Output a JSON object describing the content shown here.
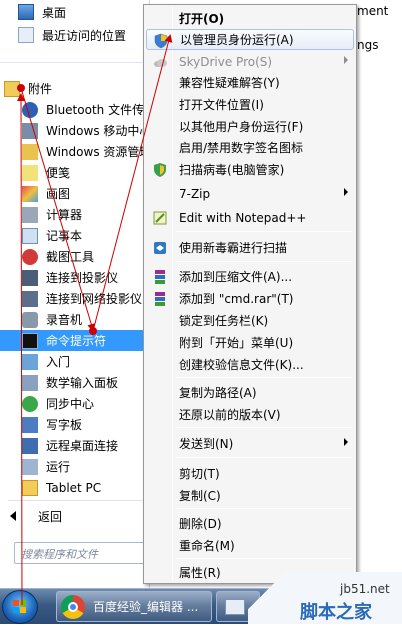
{
  "start_menu": {
    "top_items": [
      {
        "label": "桌面",
        "icon": "desktop-icon"
      },
      {
        "label": "最近访问的位置",
        "icon": "recent-places-icon"
      }
    ],
    "folder": {
      "label": "附件",
      "icon": "folder-icon"
    },
    "programs": [
      {
        "label": "Bluetooth 文件传送",
        "icon": "bluetooth-icon"
      },
      {
        "label": "Windows 移动中心",
        "icon": "mobility-center-icon"
      },
      {
        "label": "Windows 资源管理器",
        "icon": "explorer-icon"
      },
      {
        "label": "便笺",
        "icon": "sticky-notes-icon"
      },
      {
        "label": "画图",
        "icon": "paint-icon"
      },
      {
        "label": "计算器",
        "icon": "calculator-icon"
      },
      {
        "label": "记事本",
        "icon": "notepad-icon"
      },
      {
        "label": "截图工具",
        "icon": "snipping-tool-icon"
      },
      {
        "label": "连接到投影仪",
        "icon": "projector-icon"
      },
      {
        "label": "连接到网络投影仪",
        "icon": "network-projector-icon"
      },
      {
        "label": "录音机",
        "icon": "sound-recorder-icon"
      },
      {
        "label": "命令提示符",
        "icon": "command-prompt-icon"
      },
      {
        "label": "入门",
        "icon": "getting-started-icon"
      },
      {
        "label": "数学输入面板",
        "icon": "math-input-icon"
      },
      {
        "label": "同步中心",
        "icon": "sync-center-icon"
      },
      {
        "label": "写字板",
        "icon": "wordpad-icon"
      },
      {
        "label": "远程桌面连接",
        "icon": "remote-desktop-icon"
      },
      {
        "label": "运行",
        "icon": "run-icon"
      },
      {
        "label": "Tablet PC",
        "icon": "folder-icon"
      }
    ],
    "back_label": "返回",
    "search_placeholder": "搜索程序和文件"
  },
  "right_fragments": [
    "ment",
    "ngs"
  ],
  "context_menu": {
    "items": [
      {
        "label": "打开(O)",
        "bold": true
      },
      {
        "label": "以管理员身份运行(A)",
        "icon": "uac-shield-icon",
        "hover": true
      },
      {
        "label": "SkyDrive Pro(S)",
        "icon": "cloud-icon",
        "disabled": true,
        "submenu": true
      },
      {
        "label": "兼容性疑难解答(Y)"
      },
      {
        "label": "打开文件位置(I)"
      },
      {
        "label": "以其他用户身份运行(F)"
      },
      {
        "label": "启用/禁用数字签名图标"
      },
      {
        "label": "扫描病毒(电脑管家)",
        "icon": "antivirus-shield-icon"
      },
      {
        "label": "7-Zip",
        "submenu": true
      },
      {
        "label": "Edit with Notepad++",
        "icon": "notepadpp-icon"
      },
      {
        "label": "使用新毒霸进行扫描",
        "icon": "duba-icon"
      },
      {
        "label": "添加到压缩文件(A)...",
        "icon": "winrar-icon"
      },
      {
        "label": "添加到 \"cmd.rar\"(T)",
        "icon": "winrar-icon"
      },
      {
        "label": "锁定到任务栏(K)"
      },
      {
        "label": "附到「开始」菜单(U)"
      },
      {
        "label": "创建校验信息文件(K)..."
      },
      {
        "label": "复制为路径(A)"
      },
      {
        "label": "还原以前的版本(V)"
      },
      {
        "label": "发送到(N)",
        "submenu": true
      },
      {
        "label": "剪切(T)"
      },
      {
        "label": "复制(C)"
      },
      {
        "label": "删除(D)"
      },
      {
        "label": "重命名(M)"
      },
      {
        "label": "属性(R)"
      }
    ]
  },
  "taskbar": {
    "buttons": [
      {
        "label": "百度经验_编辑器 ...",
        "icon": "chrome-icon"
      },
      {
        "label": "",
        "icon": "window-icon"
      }
    ]
  },
  "watermark": {
    "line1": "jb51.net",
    "line2": "脚本之家"
  },
  "colors": {
    "selection": "#3399ff",
    "menu_bg": "#f5f5f5",
    "annotation": "#cc0000"
  }
}
